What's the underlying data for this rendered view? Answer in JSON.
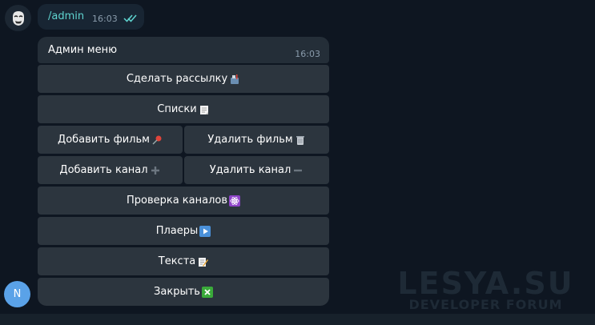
{
  "outgoing": {
    "command": "/admin",
    "time": "16:03",
    "read_status_icon": "double-check-icon"
  },
  "incoming": {
    "text": "Админ меню",
    "time": "16:03"
  },
  "keyboard": {
    "send_broadcast": "Сделать рассылку",
    "lists": "Списки",
    "add_film": "Добавить фильм",
    "delete_film": "Удалить фильм",
    "add_channel": "Добавить канал",
    "delete_channel": "Удалить канал",
    "check_channels": "Проверка каналов",
    "players": "Плаеры",
    "texts": "Текста",
    "close": "Закрыть"
  },
  "user_avatar": {
    "letter": "N",
    "color": "#5aa2e8"
  },
  "bot_avatar": {
    "icon": "anonymous-mask-icon"
  },
  "watermark": {
    "title": "LESYA.SU",
    "subtitle": "DEVELOPER FORUM"
  },
  "colors": {
    "background": "#0e1621",
    "bubble_in": "#242e38",
    "bubble_out": "#182533",
    "button": "#2c353e",
    "command_link": "#5fd4d0"
  }
}
